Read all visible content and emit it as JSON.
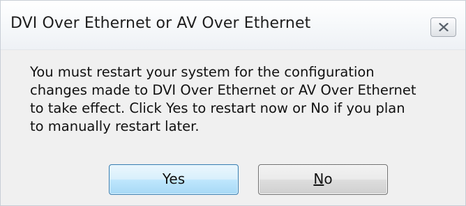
{
  "window": {
    "title": "DVI Over Ethernet or AV Over Ethernet",
    "close_icon": "close-x-icon"
  },
  "message": "You must restart your system for the configuration changes made to DVI Over Ethernet or AV Over Ethernet to take effect. Click Yes to restart now or No if you plan to manually restart later.",
  "buttons": {
    "yes_label": "Yes",
    "no_mnemonic": "N",
    "no_rest": "o"
  }
}
